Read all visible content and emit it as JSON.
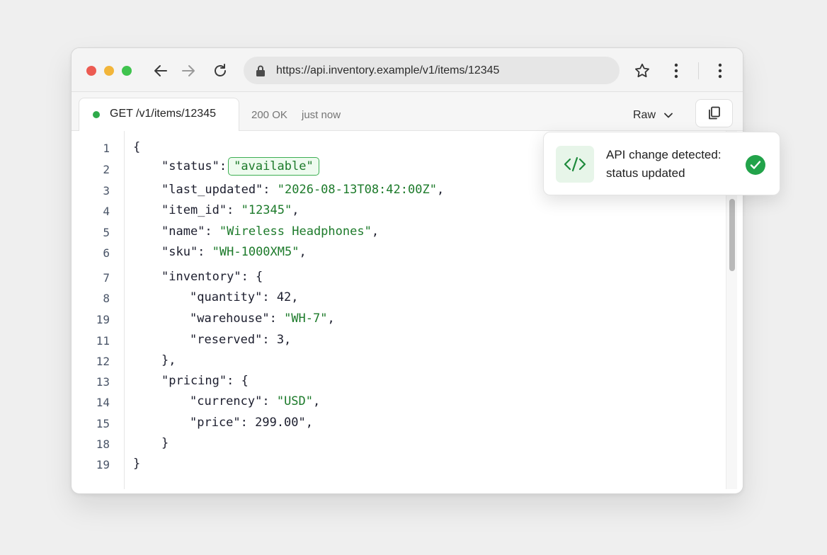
{
  "browser": {
    "url": "https://api.inventory.example/v1/items/12345"
  },
  "tab": {
    "label": "GET /v1/items/12345",
    "status_color": "#2eaa4a",
    "status_text": "200 OK",
    "time_text": "just now",
    "view_mode": "Raw"
  },
  "editor": {
    "line_numbers": [
      "1",
      "2",
      "3",
      "4",
      "5",
      "6",
      "7",
      "8",
      "19",
      "11",
      "12",
      "13",
      "14",
      "15",
      "18",
      "19"
    ],
    "lines": {
      "l1": "{",
      "l2_key": "\"status\":",
      "l2_value": "\"available\"",
      "l3_key": "\"last_updated\": ",
      "l3_value": "\"2026-08-13T08:42:00Z\"",
      "l3_end": ",",
      "l4_key": "\"item_id\": ",
      "l4_value": "\"12345\"",
      "l4_end": ",",
      "l5_key": "\"name\": ",
      "l5_value": "\"Wireless Headphones\"",
      "l5_end": ",",
      "l6_key": "\"sku\": ",
      "l6_value": "\"WH-1000XM5\"",
      "l6_end": ",",
      "l7": "\"inventory\": {",
      "l8": "\"quantity\": 42,",
      "l9_key": "\"warehouse\": ",
      "l9_value": "\"WH-7\"",
      "l9_end": ",",
      "l10": "\"reserved\": 3,",
      "l11": "},",
      "l12": "\"pricing\": {",
      "l13_key": "\"currency\": ",
      "l13_value": "\"USD\"",
      "l13_end": ",",
      "l14": "\"price\": 299.00\",",
      "l15": "}",
      "l16": "}"
    }
  },
  "toast": {
    "title": "API change detected:",
    "subtitle": "status updated",
    "accent": "#22a34a"
  }
}
